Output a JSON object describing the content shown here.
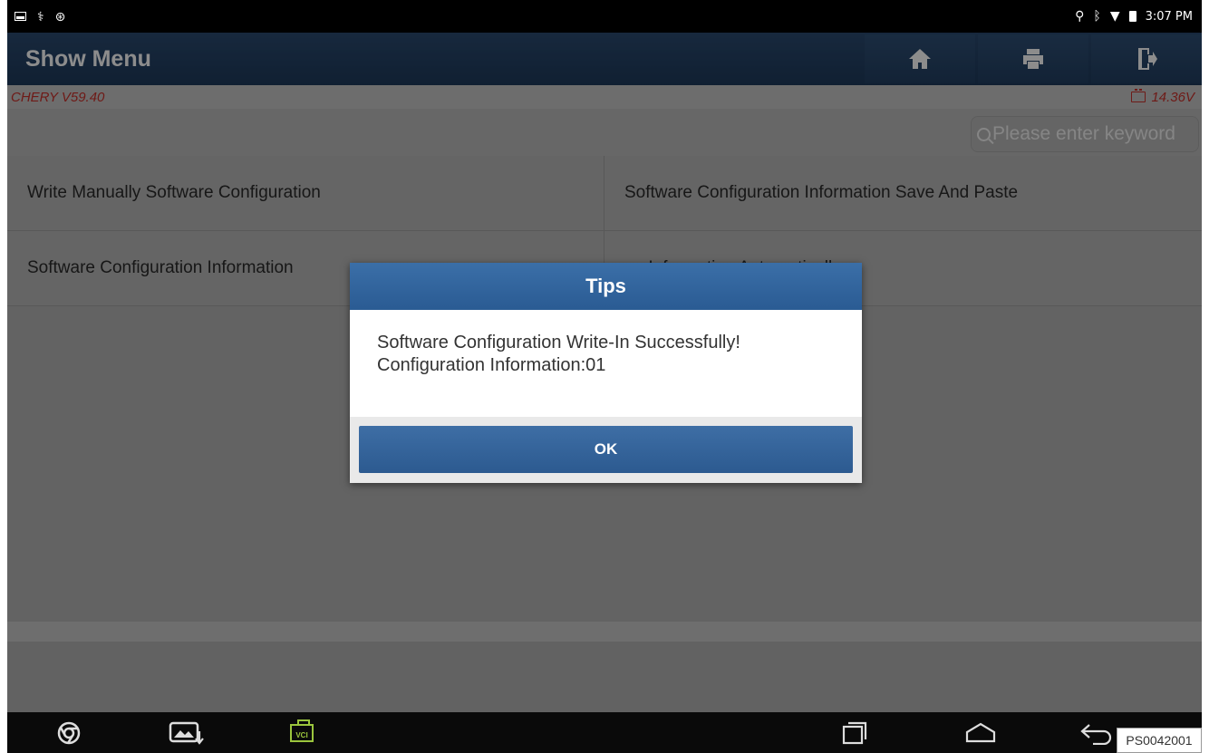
{
  "status_bar": {
    "time": "3:07 PM"
  },
  "header": {
    "title": "Show Menu"
  },
  "vehicle": {
    "name": "CHERY V59.40",
    "voltage": "14.36V"
  },
  "search": {
    "placeholder": "Please enter keyword"
  },
  "menu": {
    "items": [
      {
        "label": "Write Manually Software Configuration"
      },
      {
        "label": "Software Configuration Information Save And Paste"
      },
      {
        "label": "Software Configuration Information"
      },
      {
        "label": "on Information Automatically"
      }
    ]
  },
  "dialog": {
    "title": "Tips",
    "message_line1": "Software Configuration Write-In Successfully!",
    "message_line2": "Configuration Information:01",
    "ok_label": "OK"
  },
  "nav": {
    "vci_label": "VCI"
  },
  "figure_code": "PS0042001",
  "colors": {
    "header_bg": "#1e3a5c",
    "vehicle_text": "#c8312b",
    "dialog_title_bg": "#2a5b93",
    "vci_green": "#9bc53d"
  }
}
